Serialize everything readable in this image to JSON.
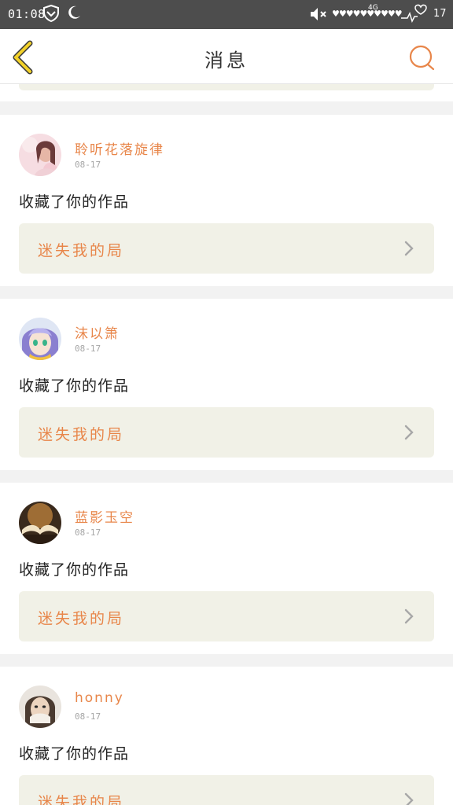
{
  "status_bar": {
    "time": "01:08",
    "network": "4G",
    "battery": "17",
    "signal_dots": "♥♥♥♥♥♥♥♥♥♥"
  },
  "header": {
    "title": "消息"
  },
  "colors": {
    "accent": "#e8864a",
    "back_icon": "#e0b400",
    "card_link_bg": "#f1f1e7"
  },
  "messages": [
    {
      "username": "聆听花落旋律",
      "date": "08-17",
      "action": "收藏了你的作品",
      "work_title": "迷失我的局"
    },
    {
      "username": "沫以箫",
      "date": "08-17",
      "action": "收藏了你的作品",
      "work_title": "迷失我的局"
    },
    {
      "username": "蓝影玉空",
      "date": "08-17",
      "action": "收藏了你的作品",
      "work_title": "迷失我的局"
    },
    {
      "username": "honny",
      "date": "08-17",
      "action": "收藏了你的作品",
      "work_title": "迷失我的局"
    }
  ]
}
